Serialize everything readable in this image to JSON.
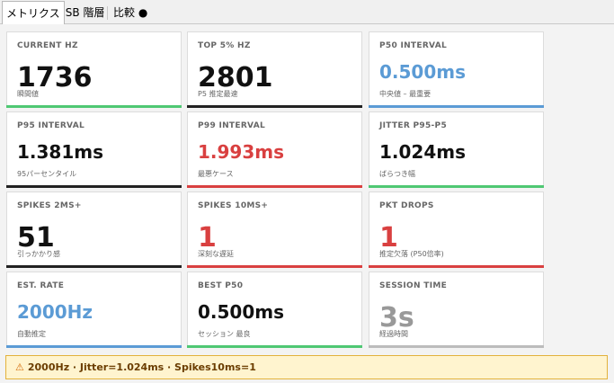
{
  "tabs": [
    {
      "label": "メトリクス",
      "active": true
    },
    {
      "label": "USB 階層",
      "active": false
    },
    {
      "label": "比較 ●",
      "active": false
    }
  ],
  "cards": [
    {
      "label": "CURRENT HZ",
      "value": "1736",
      "sub": "瞬間値",
      "value_color": "black",
      "bar_color": "green",
      "big": true
    },
    {
      "label": "TOP 5% HZ",
      "value": "2801",
      "sub": "P5 推定最速",
      "value_color": "black",
      "bar_color": "black",
      "big": true
    },
    {
      "label": "P50 INTERVAL",
      "value": "0.500ms",
      "sub": "中央値 – 最重要",
      "value_color": "blue",
      "bar_color": "blue",
      "big": false
    },
    {
      "label": "P95 INTERVAL",
      "value": "1.381ms",
      "sub": "95パーセンタイル",
      "value_color": "black",
      "bar_color": "black",
      "big": false
    },
    {
      "label": "P99 INTERVAL",
      "value": "1.993ms",
      "sub": "最悪ケース",
      "value_color": "red",
      "bar_color": "red",
      "big": false
    },
    {
      "label": "JITTER P95-P5",
      "value": "1.024ms",
      "sub": "ばらつき幅",
      "value_color": "black",
      "bar_color": "green",
      "big": false
    },
    {
      "label": "SPIKES 2MS+",
      "value": "51",
      "sub": "引っかかり感",
      "value_color": "black",
      "bar_color": "black",
      "big": true
    },
    {
      "label": "SPIKES 10MS+",
      "value": "1",
      "sub": "深刻な遅延",
      "value_color": "red",
      "bar_color": "red",
      "big": true
    },
    {
      "label": "PKT DROPS",
      "value": "1",
      "sub": "推定欠落 (P50倍率)",
      "value_color": "red",
      "bar_color": "red",
      "big": true
    },
    {
      "label": "EST. RATE",
      "value": "2000Hz",
      "sub": "自動推定",
      "value_color": "blue",
      "bar_color": "blue",
      "big": false
    },
    {
      "label": "BEST P50",
      "value": "0.500ms",
      "sub": "セッション 最良",
      "value_color": "black",
      "bar_color": "green",
      "big": false
    },
    {
      "label": "SESSION TIME",
      "value": "3s",
      "sub": "経過時間",
      "value_color": "gray",
      "bar_color": "gray",
      "big": true
    }
  ],
  "status": {
    "icon": "warning-icon",
    "text": "2000Hz · Jitter=1.024ms · Spikes10ms=1"
  },
  "colors": {
    "green": "#4fc873",
    "black": "#222222",
    "blue": "#5b9bd5",
    "red": "#d94040",
    "gray": "#bcbcbc",
    "status_bg": "#fff4cf",
    "status_border": "#e2b23c"
  }
}
